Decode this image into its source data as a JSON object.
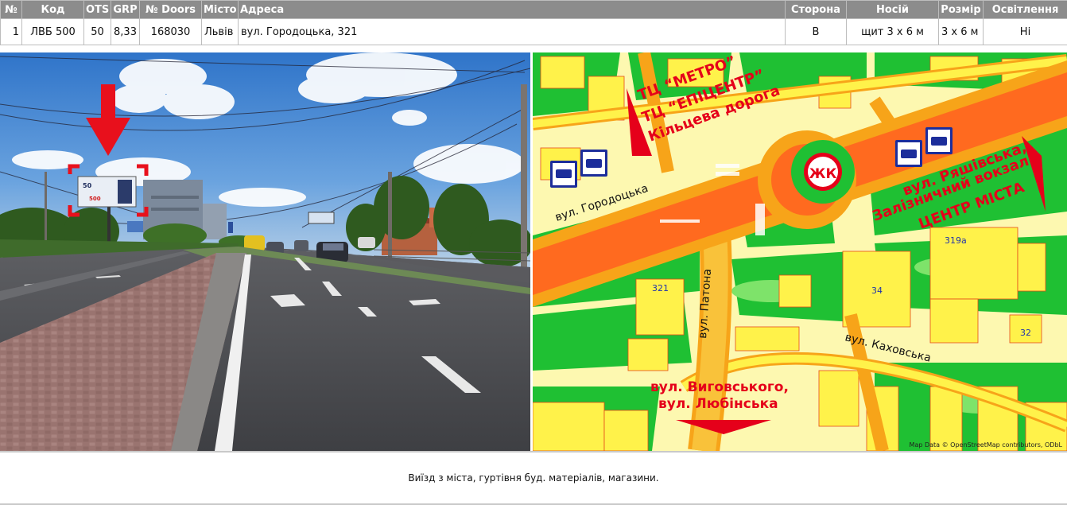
{
  "table": {
    "headers": [
      "№",
      "Код",
      "OTS",
      "GRP",
      "№ Doors",
      "Місто",
      "Адреса",
      "Сторона",
      "Носій",
      "Розмір",
      "Освітлення"
    ],
    "row": {
      "num": "1",
      "code": "ЛВБ 500",
      "ots": "50",
      "grp": "8,33",
      "doors": "168030",
      "city": "Львів",
      "address": "вул. Городоцька, 321",
      "side": "B",
      "carrier": "щит 3 х 6 м",
      "size": "3 х 6 м",
      "lighting": "Ні"
    }
  },
  "photo": {
    "billboard_text": "50",
    "billboard_price": "500"
  },
  "map": {
    "labels": {
      "metro": "ТЦ “МЕТРО”",
      "epicenter": "ТЦ “ЕПІЦЕНТР”",
      "ring_road": "Кільцева дорога",
      "ryashivska": "вул. Ряшівська,",
      "station": "Залізничний вокзал,",
      "center": "ЦЕНТР МІСТА",
      "vygovskogo": "вул. Виговського,",
      "lyubinska": "вул. Любінська",
      "gorodotska": "вул. Городоцька",
      "patona": "вул. Патона",
      "kakhovska": "вул. Каховська",
      "num_321": "321",
      "num_34": "34",
      "num_319a": "319а",
      "num_32": "32",
      "logo": "ЖК",
      "credit": "Map Data © OpenStreetMap contributors, ODbL"
    },
    "colors": {
      "road": "#ff6a1f",
      "road_edge": "#f7a419",
      "green": "#1fc033",
      "light_green": "#7ee36a",
      "building": "#fff24a",
      "pale": "#fdf8b0",
      "red": "#e5001a"
    },
    "icons": [
      "bus-icon",
      "trolleybus-icon"
    ]
  },
  "description": "Виїзд з міста, гуртівня буд. матеріалів, магазини."
}
